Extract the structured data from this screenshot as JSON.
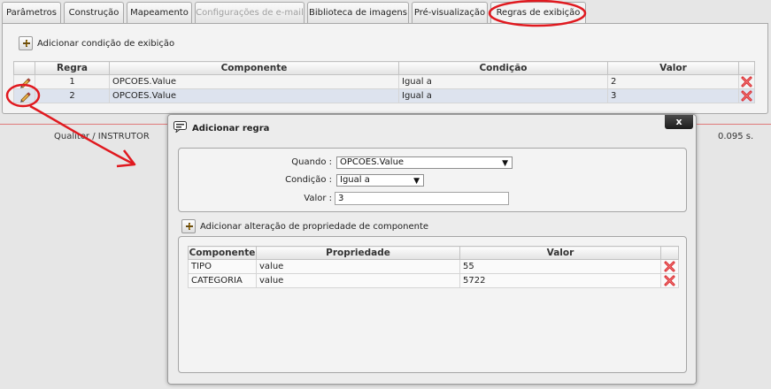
{
  "tabs": [
    {
      "label": "Parâmetros",
      "state": "normal"
    },
    {
      "label": "Construção",
      "state": "normal"
    },
    {
      "label": "Mapeamento",
      "state": "normal"
    },
    {
      "label": "Configurações de e-mail",
      "state": "disabled"
    },
    {
      "label": "Biblioteca de imagens",
      "state": "normal"
    },
    {
      "label": "Pré-visualização",
      "state": "normal"
    },
    {
      "label": "Regras de exibição",
      "state": "active"
    }
  ],
  "rules_panel": {
    "add_condition_label": "Adicionar condição de exibição",
    "columns": [
      "Regra",
      "Componente",
      "Condição",
      "Valor"
    ],
    "rows": [
      {
        "regra": "1",
        "componente": "OPCOES.Value",
        "condicao": "Igual a",
        "valor": "2"
      },
      {
        "regra": "2",
        "componente": "OPCOES.Value",
        "condicao": "Igual a",
        "valor": "3"
      }
    ]
  },
  "footer": {
    "left_text": "Qualitor / INSTRUTOR",
    "right_text": "0.095 s."
  },
  "dialog": {
    "title": "Adicionar regra",
    "close_label": "x",
    "when_label": "Quando :",
    "when_value": "OPCOES.Value",
    "condition_label": "Condição :",
    "condition_value": "Igual a",
    "value_label": "Valor :",
    "value_value": "3",
    "add_property_label": "Adicionar alteração de propriedade de componente",
    "columns": [
      "Componente",
      "Propriedade",
      "Valor"
    ],
    "rows": [
      {
        "componente": "TIPO",
        "propriedade": "value",
        "valor": "55"
      },
      {
        "componente": "CATEGORIA",
        "propriedade": "value",
        "valor": "5722"
      }
    ]
  },
  "colors": {
    "annotation_red": "#e0191f",
    "selected_row": "#dde3ee",
    "delete_icon_red": "#d8262b"
  },
  "icons": [
    "plus-icon",
    "pencil-icon",
    "delete-icon",
    "dialog-icon",
    "close-icon",
    "dropdown-caret-icon"
  ]
}
